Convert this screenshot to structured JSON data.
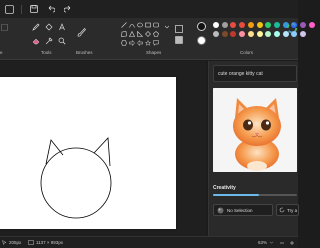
{
  "ribbon": {
    "groups": [
      "Tools",
      "Brushes",
      "Shapes",
      "Colors"
    ],
    "left_group_partial": "e"
  },
  "colors": {
    "primary": "#1c1c1c",
    "secondary": "#ffffff",
    "palette": [
      "#ffffff",
      "#a0a0a0",
      "#e84c3d",
      "#e74c3c",
      "#f39c12",
      "#f1c40f",
      "#2ecc71",
      "#1abc9c",
      "#3498db",
      "#2d6ef5",
      "#9b59b6",
      "#ff5fc8",
      "#bbbbbb",
      "#7b4b2a",
      "#c0392b",
      "#ff8fa3",
      "#ffe08a",
      "#fff59d",
      "#b9f6ca",
      "#a7ffeb",
      "#b3e5fc",
      "#90caf9",
      "#d1c4e9"
    ],
    "accent": "#6cb8e8"
  },
  "cocreator": {
    "prompt": "cute orange kitty cat",
    "creativity_label": "Creativity",
    "creativity_level": 0.55,
    "style": "No Selection",
    "try_label": "Try a"
  },
  "status": {
    "cursor": "205px",
    "canvas_size": "1137 × 993px",
    "zoom": "63%"
  },
  "icons": [
    "paint-app-icon",
    "save-icon",
    "undo-icon",
    "redo-icon",
    "pencil-icon",
    "fill-icon",
    "text-icon",
    "eraser-icon",
    "color-picker-icon",
    "magnifier-icon",
    "brush-icon",
    "color-wheel-icon",
    "shape-outline-icon",
    "shape-fill-icon",
    "style-icon",
    "try-icon",
    "pointer-icon",
    "canvas-size-icon",
    "zoom-out-icon",
    "zoom-in-icon"
  ]
}
